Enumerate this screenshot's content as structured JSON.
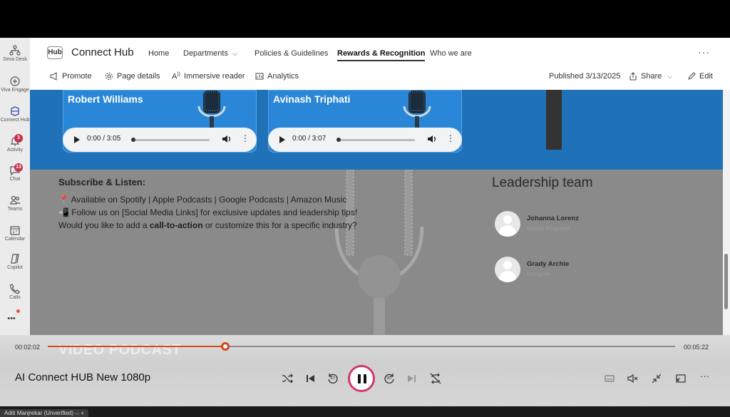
{
  "rail": {
    "items": [
      {
        "label": "Seva Desk",
        "badge": ""
      },
      {
        "label": "Viva Engage",
        "badge": ""
      },
      {
        "label": "Connect Hub",
        "badge": ""
      },
      {
        "label": "Activity",
        "badge": "3"
      },
      {
        "label": "Chat",
        "badge": "13"
      },
      {
        "label": "Teams",
        "badge": ""
      },
      {
        "label": "Calendar",
        "badge": ""
      },
      {
        "label": "Copilot",
        "badge": ""
      },
      {
        "label": "Calls",
        "badge": ""
      }
    ],
    "more": "•••"
  },
  "header": {
    "logo": "Hub",
    "site_title": "Connect Hub",
    "nav": [
      "Home",
      "Departments",
      "Policies & Guidelines",
      "Rewards & Recognition",
      "Who we are"
    ],
    "nav_dropdown_glyph": "⌵",
    "more": "···",
    "commands": {
      "promote": "Promote",
      "page_details": "Page details",
      "immersive_reader": "Immersive reader",
      "analytics": "Analytics",
      "published": "Published 3/13/2025",
      "share": "Share",
      "edit": "Edit"
    }
  },
  "audio_cards": [
    {
      "name": "Robert Williams",
      "time": "0:00 / 3:05"
    },
    {
      "name": "Avinash Triphati",
      "time": "0:00 / 3:07"
    }
  ],
  "subscribe": {
    "title": "Subscribe & Listen:",
    "line1_prefix": "Available on ",
    "line1_links": "Spotify | Apple Podcasts | Google Podcasts | Amazon Music",
    "line2": "Follow us on [Social Media Links] for exclusive updates and leadership tips!",
    "line3_prefix": "Would you like to add a ",
    "line3_bold": "call-to-action",
    "line3_suffix": " or customize this for a specific industry?"
  },
  "leadership": {
    "title": "Leadership team",
    "people": [
      {
        "name": "Johanna Lorenz",
        "role": "Senior Engineer"
      },
      {
        "name": "Grady Archie",
        "role": "Designer"
      }
    ]
  },
  "video": {
    "overlay_heading": "VIDEO PODCAST",
    "current_time": "00:02:02",
    "total_time": "00:05:22",
    "progress": 0.2832,
    "title": "AI Connect HUB New 1080p",
    "rewind_label": "10",
    "forward_label": "30",
    "accent": "#d9461c"
  },
  "bottom": {
    "user_tag": "Aditi Manjrekar (Unverified)"
  }
}
